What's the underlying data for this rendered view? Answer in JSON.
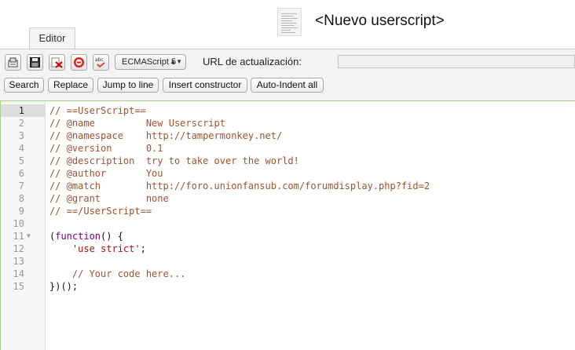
{
  "header": {
    "title": "<Nuevo userscript>",
    "tab_label": "Editor"
  },
  "toolbar": {
    "icons": [
      "save-to-disk-icon",
      "save-icon",
      "close-discard-icon",
      "disable-icon",
      "spellcheck-icon"
    ],
    "language_select": "ECMAScript 5",
    "url_label": "URL de actualización:",
    "url_value": "",
    "buttons": {
      "search": "Search",
      "replace": "Replace",
      "jump": "Jump to line",
      "insert": "Insert constructor",
      "autoindent": "Auto-Indent all"
    }
  },
  "editor": {
    "lines": [
      {
        "num": "1",
        "text": "// ==UserScript==",
        "type": "comment"
      },
      {
        "num": "2",
        "text": "// @name         New Userscript",
        "type": "comment"
      },
      {
        "num": "3",
        "text": "// @namespace    http://tampermonkey.net/",
        "type": "comment"
      },
      {
        "num": "4",
        "text": "// @version      0.1",
        "type": "comment"
      },
      {
        "num": "5",
        "text": "// @description  try to take over the world!",
        "type": "comment"
      },
      {
        "num": "6",
        "text": "// @author       You",
        "type": "comment"
      },
      {
        "num": "7",
        "text": "// @match        http://foro.unionfansub.com/forumdisplay.php?fid=2",
        "type": "comment"
      },
      {
        "num": "8",
        "text": "// @grant        none",
        "type": "comment"
      },
      {
        "num": "9",
        "text": "// ==/UserScript==",
        "type": "comment"
      },
      {
        "num": "10",
        "text": "",
        "type": "plain"
      },
      {
        "num": "11",
        "text": "(function() {",
        "type": "code"
      },
      {
        "num": "12",
        "text": "    'use strict';",
        "type": "code"
      },
      {
        "num": "13",
        "text": "",
        "type": "plain"
      },
      {
        "num": "14",
        "text": "    // Your code here...",
        "type": "comment"
      },
      {
        "num": "15",
        "text": "})();",
        "type": "plain"
      }
    ],
    "active_line": "1",
    "fold_line": "11"
  },
  "colors": {
    "comment": "#a0522d",
    "keyword": "#770088",
    "string": "#aa1111",
    "editor_border": "#a6d28a"
  }
}
